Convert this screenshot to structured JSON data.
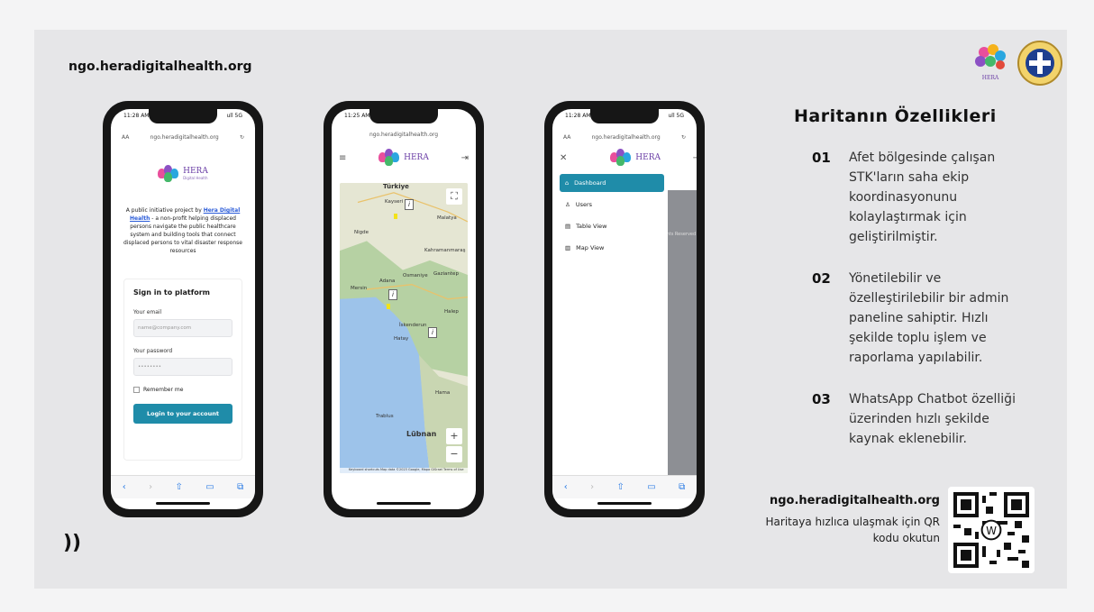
{
  "site": "ngo.heradigitalhealth.org",
  "chevron": "))",
  "features_title": "Haritanın Özellikleri",
  "features": [
    {
      "num": "01",
      "text": "Afet bölgesinde çalışan STK'ların saha ekip koordinasyonunu kolaylaştırmak için geliştirilmiştir."
    },
    {
      "num": "02",
      "text": "Yönetilebilir ve özelleştirilebilir bir admin paneline sahiptir. Hızlı şekilde toplu işlem ve raporlama yapılabilir."
    },
    {
      "num": "03",
      "text": "WhatsApp Chatbot özelliği üzerinden hızlı şekilde kaynak eklenebilir."
    }
  ],
  "qr": {
    "site": "ngo.heradigitalhealth.org",
    "text": "Haritaya hızlıca ulaşmak için QR kodu okutun"
  },
  "phone1": {
    "time": "11:28 AM",
    "signal": "ull 5G",
    "aa": "AA",
    "url": "ngo.heradigitalhealth.org",
    "brand": "HERA",
    "brand_sub": "Digital Health",
    "intro_pre": "A public initiative project by ",
    "intro_link": "Hera Digital Health",
    "intro_post": " - a non-profit helping displaced persons navigate the public healthcare system and building tools that connect displaced persons to vital disaster response resources",
    "signin": "Sign in to platform",
    "email_label": "Your email",
    "email_ph": "name@company.com",
    "pass_label": "Your password",
    "pass_ph": "••••••••",
    "remember": "Remember me",
    "login": "Login to your account"
  },
  "phone2": {
    "time": "11:25 AM",
    "url": "ngo.heradigitalhealth.org",
    "cities": [
      "Türkiye",
      "Kayseri",
      "Nigde",
      "Malatya",
      "Kahramanmaraş",
      "Adana",
      "Mersin",
      "Osmaniye",
      "Gaziantep",
      "Halep",
      "Hatay",
      "İskenderun",
      "Hama",
      "Trablus",
      "Lübnan"
    ],
    "zoom_in": "+",
    "zoom_out": "−",
    "credit": "Keyboard shortcuts  Map data ©2023 Google, Mapa GISrael  Terms of Use"
  },
  "phone3": {
    "time": "11:28 AM",
    "url": "ngo.heradigitalhealth.org",
    "nav": [
      "Dashboard",
      "Users",
      "Table View",
      "Map View"
    ],
    "faded": "ights Reserved"
  }
}
